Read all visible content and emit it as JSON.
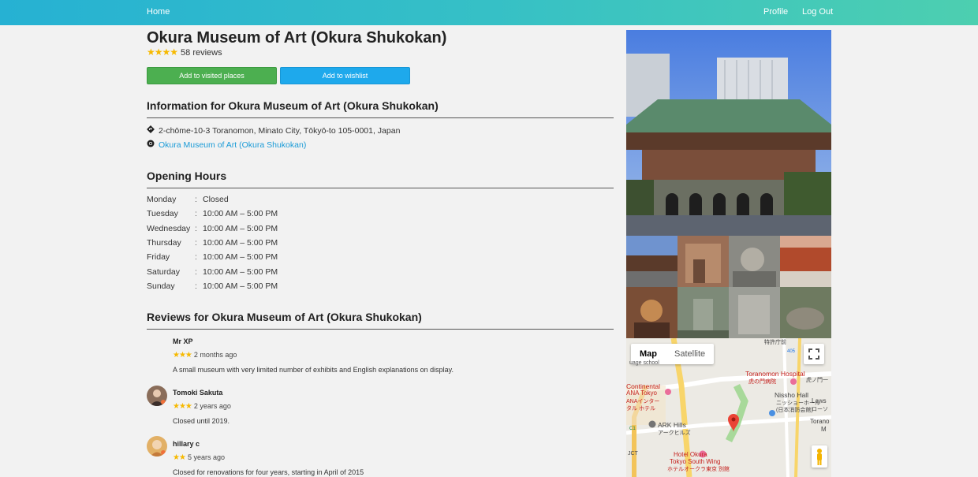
{
  "nav": {
    "home": "Home",
    "profile": "Profile",
    "logout": "Log Out"
  },
  "place": {
    "title": "Okura Museum of Art (Okura Shukokan)",
    "stars": "★★★★",
    "review_count": "58 reviews",
    "btn_visited": "Add to visited places",
    "btn_wishlist": "Add to wishlist"
  },
  "info": {
    "heading": "Information for Okura Museum of Art (Okura Shukokan)",
    "address_icon": "directions-icon",
    "address": "2-chōme-10-3 Toranomon, Minato City, Tōkyō-to 105-0001, Japan",
    "website_icon": "chrome-icon",
    "website": "Okura Museum of Art (Okura Shukokan)"
  },
  "hours": {
    "heading": "Opening Hours",
    "sep": ":",
    "days": [
      {
        "day": "Monday",
        "time": "Closed"
      },
      {
        "day": "Tuesday",
        "time": "10:00 AM – 5:00 PM"
      },
      {
        "day": "Wednesday",
        "time": "10:00 AM – 5:00 PM"
      },
      {
        "day": "Thursday",
        "time": "10:00 AM – 5:00 PM"
      },
      {
        "day": "Friday",
        "time": "10:00 AM – 5:00 PM"
      },
      {
        "day": "Saturday",
        "time": "10:00 AM – 5:00 PM"
      },
      {
        "day": "Sunday",
        "time": "10:00 AM – 5:00 PM"
      }
    ]
  },
  "reviews": {
    "heading": "Reviews for Okura Museum of Art (Okura Shukokan)",
    "items": [
      {
        "name": "Mr XP",
        "stars": "★★★",
        "time": "2 months ago",
        "text": "A small museum with very limited number of exhibits and English explanations on display."
      },
      {
        "name": "Tomoki Sakuta",
        "stars": "★★★",
        "time": "2 years ago",
        "text": "Closed until 2019."
      },
      {
        "name": "hillary c",
        "stars": "★★",
        "time": "5 years ago",
        "text": "Closed for renovations for four years, starting in April of 2015"
      }
    ]
  },
  "map": {
    "tab_map": "Map",
    "tab_satellite": "Satellite",
    "labels": {
      "hospital": "Toranomon Hospital",
      "hospital_jp": "虎の門病院",
      "nissho": "Nissho Hall",
      "nissho_jp": "ニッショーホール",
      "nissho_jp2": "(日本消防会館)",
      "continental": "Continental",
      "ana": "ANA Tokyo",
      "ana_jp": "ANAインター",
      "ana_jp2": "タル ホテル",
      "ark": "ARK Hills",
      "ark_jp": "アークヒルズ",
      "okura1": "Hotel Okura",
      "okura2": "Tokyo South Wing",
      "okura_jp": "ホテルオークラ東京 別館",
      "lawson": "Laws",
      "lawson_jp": "ローソ",
      "torano": "Torano",
      "torano2": "M",
      "toranomon_ichome": "虎ノ門一",
      "jct": "JCT",
      "tokkyo": "特許庁前",
      "route": "405",
      "shortcut": "C1",
      "toranomon_sub": "虎ノ門",
      "jct2": "JCT",
      "ra": "ra",
      "tama": "mon",
      "kiyo": "uage school"
    }
  }
}
